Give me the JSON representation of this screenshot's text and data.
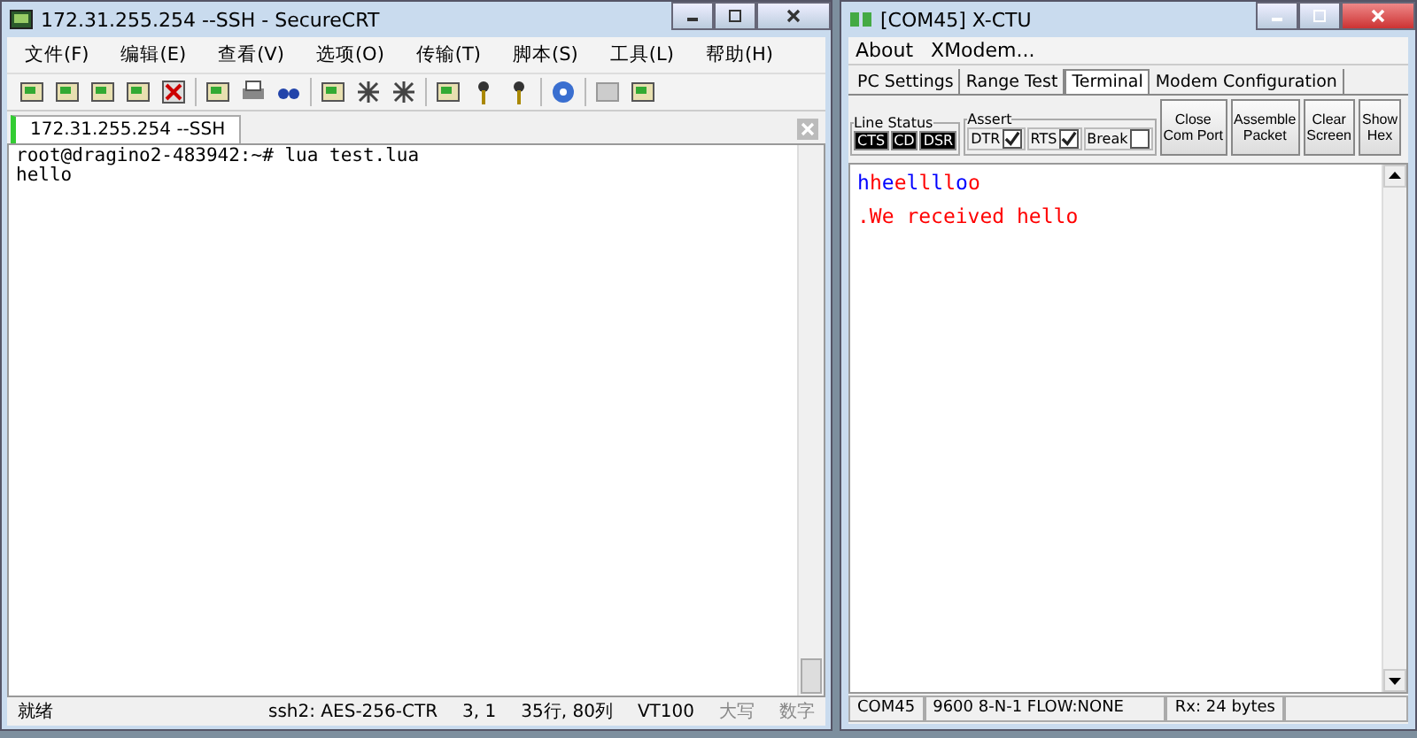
{
  "left_window": {
    "title": "172.31.255.254 --SSH - SecureCRT",
    "menu": [
      "文件(F)",
      "编辑(E)",
      "查看(V)",
      "选项(O)",
      "传输(T)",
      "脚本(S)",
      "工具(L)",
      "帮助(H)"
    ],
    "tabs": [
      {
        "label": "172.31.255.254 --SSH",
        "selected": true
      }
    ],
    "terminal_lines": [
      "root@dragino2-483942:~# lua test.lua",
      "hello"
    ],
    "status_bar": [
      "就绪",
      "ssh2: AES-256-CTR",
      "3,  1",
      "35行, 80列",
      "VT100",
      "大写",
      "数字"
    ]
  },
  "right_window": {
    "title": "[COM45] X-CTU",
    "menu": [
      "About",
      "XModem..."
    ],
    "tabs": [
      {
        "label": "PC Settings",
        "selected": false
      },
      {
        "label": "Range Test",
        "selected": false
      },
      {
        "label": "Terminal",
        "selected": true
      },
      {
        "label": "Modem Configuration",
        "selected": false
      }
    ],
    "line_status": {
      "title": "Line Status",
      "indicators": [
        "CTS",
        "CD",
        "DSR"
      ]
    },
    "assert": {
      "title": "Assert",
      "options": [
        {
          "label": "DTR",
          "checked": true
        },
        {
          "label": "RTS",
          "checked": true
        },
        {
          "label": "Break",
          "checked": false
        }
      ]
    },
    "buttons": [
      [
        "Close",
        "Com Port"
      ],
      [
        "Assemble",
        "Packet"
      ],
      [
        "Clear",
        "Screen"
      ],
      [
        "Show",
        "Hex"
      ]
    ],
    "terminal_lines": [
      [
        {
          "text": "h",
          "color": "#0000ff"
        },
        {
          "text": "h",
          "color": "#ff0000"
        },
        {
          "text": "e",
          "color": "#0000ff"
        },
        {
          "text": "e",
          "color": "#ff0000"
        },
        {
          "text": "l",
          "color": "#0000ff"
        },
        {
          "text": "l",
          "color": "#ff0000"
        },
        {
          "text": "l",
          "color": "#0000ff"
        },
        {
          "text": "l",
          "color": "#ff0000"
        },
        {
          "text": "o",
          "color": "#0000ff"
        },
        {
          "text": "o",
          "color": "#ff0000"
        }
      ],
      [
        {
          "text": ".We received hello",
          "color": "#ff0000"
        }
      ]
    ],
    "status_bar": [
      "COM45",
      "9600 8-N-1  FLOW:NONE",
      "Rx: 24 bytes"
    ]
  }
}
